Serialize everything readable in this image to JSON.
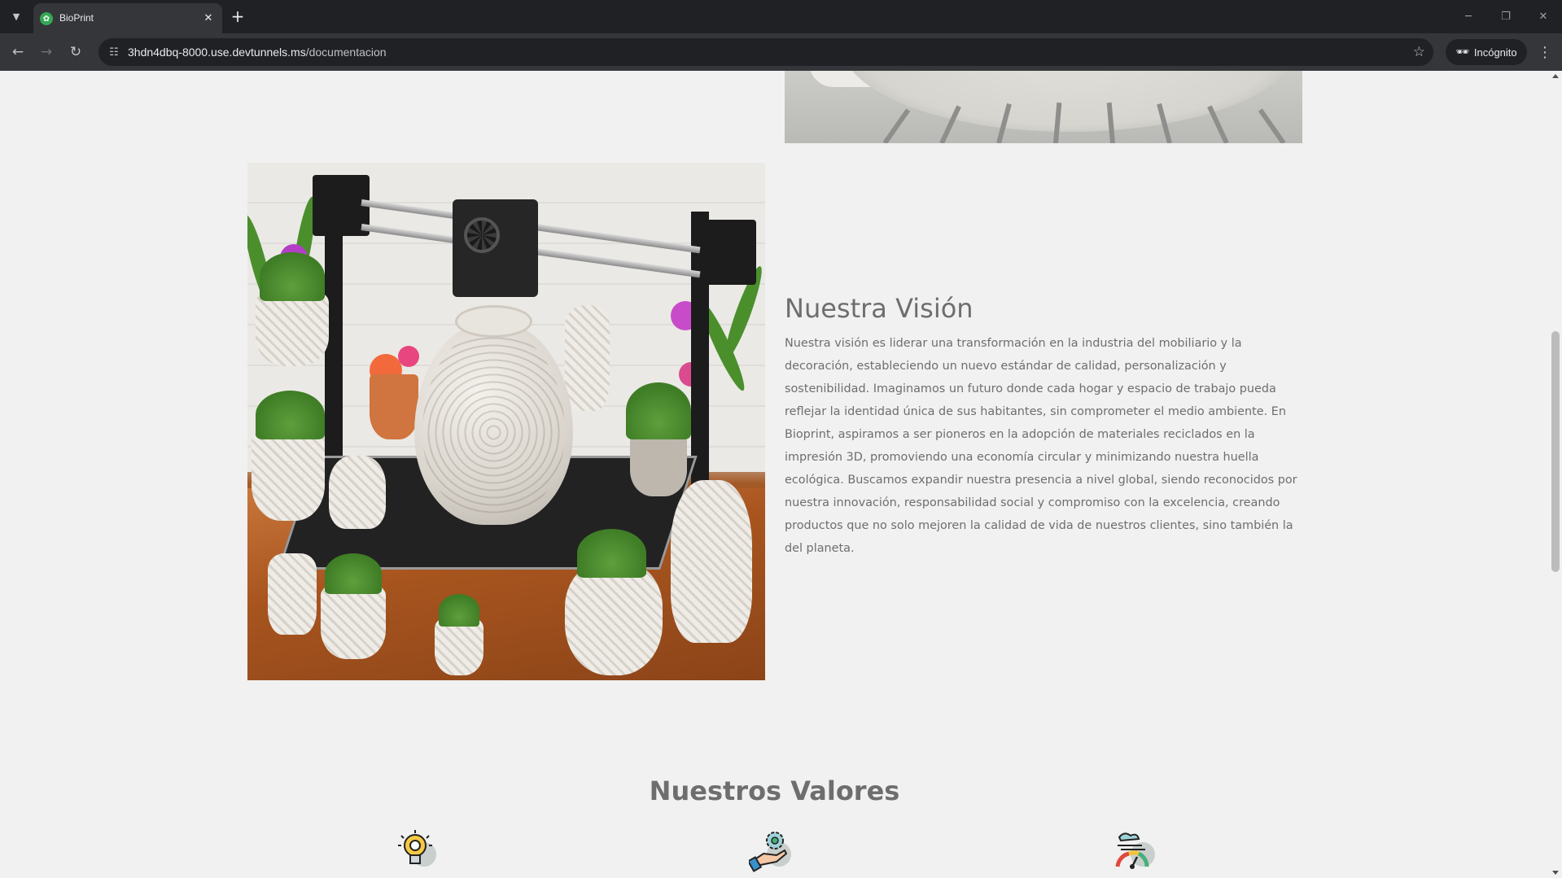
{
  "browser": {
    "tab_title": "BioPrint",
    "url_host": "3hdn4dbq-8000.use.devtunnels.ms",
    "url_path": "/documentacion",
    "incognito_label": "Incógnito"
  },
  "vision": {
    "title": "Nuestra Visión",
    "text": "Nuestra visión es liderar una transformación en la industria del mobiliario y la decoración, estableciendo un nuevo estándar de calidad, personalización y sostenibilidad. Imaginamos un futuro donde cada hogar y espacio de trabajo pueda reflejar la identidad única de sus habitantes, sin comprometer el medio ambiente. En Bioprint, aspiramos a ser pioneros en la adopción de materiales reciclados en la impresión 3D, promoviendo una economía circular y minimizando nuestra huella ecológica. Buscamos expandir nuestra presencia a nivel global, siendo reconocidos por nuestra innovación, responsabilidad social y compromiso con la excelencia, creando productos que no solo mejoren la calidad de vida de nuestros clientes, sino también la del planeta."
  },
  "values": {
    "title": "Nuestros Valores",
    "icons": [
      "innovation-lightbulb-icon",
      "sustainability-hand-gear-icon",
      "performance-gauge-icon"
    ]
  },
  "colors": {
    "page_bg": "#f0f1f0",
    "text": "#6e6e6e",
    "chrome_bg": "#202124",
    "toolbar_bg": "#35363a"
  }
}
